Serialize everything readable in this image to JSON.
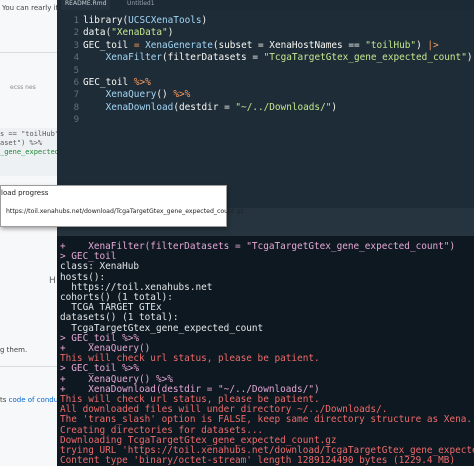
{
  "browser": {
    "top_text": "You can rearly it",
    "ec_text": "ecss nes",
    "code_lines": [
      {
        "text": "s == \"toilHub\")",
        "green": false
      },
      {
        "text": "aset\") %>%",
        "green": false
      },
      {
        "text": "_gene_expected_",
        "green": true
      }
    ],
    "h_letter": "H",
    "them_text": "g them.",
    "conduct_prefix": "ts ",
    "conduct_link": "code of conduct."
  },
  "editor": {
    "tabs": [
      "README.Rmd",
      "Untitled1"
    ],
    "lines": [
      {
        "n": "1",
        "tokens": [
          [
            "k",
            "library("
          ],
          [
            "fn",
            "UCSCXenaTools"
          ],
          [
            "k",
            ")"
          ]
        ]
      },
      {
        "n": "2",
        "tokens": [
          [
            "k",
            "data("
          ],
          [
            "s",
            "\"XenaData\""
          ],
          [
            "k",
            ")"
          ]
        ]
      },
      {
        "n": "3",
        "tokens": [
          [
            "k",
            "GEC_toil "
          ],
          [
            "op",
            "="
          ],
          [
            "k",
            " "
          ],
          [
            "fn",
            "XenaGenerate"
          ],
          [
            "k",
            "(subset = XenaHostNames == "
          ],
          [
            "s",
            "\"toilHub\""
          ],
          [
            "k",
            ") "
          ],
          [
            "op",
            "|>"
          ]
        ]
      },
      {
        "n": "4",
        "tokens": [
          [
            "k",
            "    "
          ],
          [
            "fn",
            "XenaFilter"
          ],
          [
            "k",
            "(filterDatasets = "
          ],
          [
            "s",
            "\"TcgaTargetGtex_gene_expected_count\""
          ],
          [
            "k",
            ")"
          ]
        ]
      },
      {
        "n": "5",
        "tokens": []
      },
      {
        "n": "6",
        "tokens": [
          [
            "k",
            "GEC_toil "
          ],
          [
            "op",
            "%>%"
          ]
        ]
      },
      {
        "n": "7",
        "tokens": [
          [
            "k",
            "    "
          ],
          [
            "fn",
            "XenaQuery"
          ],
          [
            "k",
            "() "
          ],
          [
            "op",
            "%>%"
          ]
        ]
      },
      {
        "n": "8",
        "tokens": [
          [
            "k",
            "    "
          ],
          [
            "fn",
            "XenaDownload"
          ],
          [
            "k",
            "(destdir = "
          ],
          [
            "s",
            "\"~/../Downloads/\""
          ],
          [
            "k",
            ")"
          ]
        ]
      },
      {
        "n": "9",
        "tokens": []
      }
    ]
  },
  "console": {
    "lines": [
      {
        "c": "prompt",
        "t": "+    XenaFilter(filterDatasets = \"TcgaTargetGtex_gene_expected_count\")"
      },
      {
        "c": "prompt",
        "t": "> GEC_toil"
      },
      {
        "c": "out",
        "t": "class: XenaHub"
      },
      {
        "c": "out",
        "t": "hosts():"
      },
      {
        "c": "out",
        "t": "  https://toil.xenahubs.net"
      },
      {
        "c": "out",
        "t": "cohorts() (1 total):"
      },
      {
        "c": "out",
        "t": "  TCGA TARGET GTEx"
      },
      {
        "c": "out",
        "t": "datasets() (1 total):"
      },
      {
        "c": "out",
        "t": "  TcgaTargetGtex_gene_expected_count"
      },
      {
        "c": "prompt",
        "t": "> GEC_toil %>%"
      },
      {
        "c": "prompt",
        "t": "+    XenaQuery()"
      },
      {
        "c": "msg",
        "t": "This will check url status, please be patient."
      },
      {
        "c": "prompt",
        "t": "> GEC_toil %>%"
      },
      {
        "c": "prompt",
        "t": "+    XenaQuery() %>%"
      },
      {
        "c": "prompt",
        "t": "+    XenaDownload(destdir = \"~/../Downloads/\")"
      },
      {
        "c": "msg",
        "t": "This will check url status, please be patient."
      },
      {
        "c": "msg",
        "t": "All downloaded files will under directory ~/../Downloads/."
      },
      {
        "c": "msg",
        "t": "The 'trans_slash' option is FALSE, keep same directory structure as Xena."
      },
      {
        "c": "msg",
        "t": "Creating directories for datasets..."
      },
      {
        "c": "msg",
        "t": "Downloading TcgaTargetGtex_gene_expected_count.gz"
      },
      {
        "c": "msg",
        "t": "trying URL 'https://toil.xenahubs.net/download/TcgaTargetGtex_gene_expected_count.gz'"
      },
      {
        "c": "msg",
        "t": "Content type 'binary/octet-stream' length 1289124490 bytes (1229.4 MB)"
      }
    ]
  },
  "dialog": {
    "title": "load progress",
    "url": "https://toil.xenahubs.net/download/TcgaTargetGtex_gene_expected_count.gz"
  }
}
